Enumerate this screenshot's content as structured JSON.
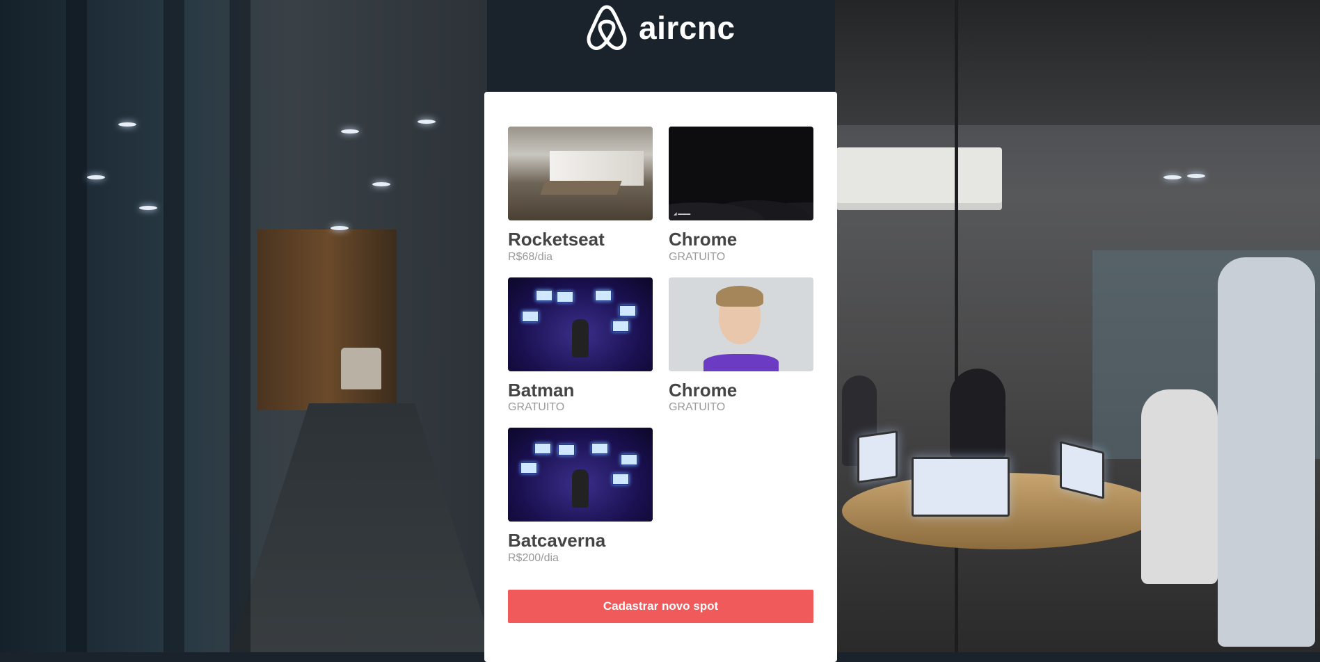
{
  "app": {
    "logo_text": "aircnc",
    "logo_icon": "airbnb-belo-icon"
  },
  "spots": [
    {
      "name": "Rocketseat",
      "price": "R$68/dia",
      "image": "office-room"
    },
    {
      "name": "Chrome",
      "price": "GRATUITO",
      "image": "dark-banner"
    },
    {
      "name": "Batman",
      "price": "GRATUITO",
      "image": "batcave"
    },
    {
      "name": "Chrome",
      "price": "GRATUITO",
      "image": "portrait"
    },
    {
      "name": "Batcaverna",
      "price": "R$200/dia",
      "image": "batcave"
    }
  ],
  "actions": {
    "new_spot_label": "Cadastrar novo spot"
  },
  "colors": {
    "accent": "#f05a5b",
    "card_bg": "#ffffff",
    "title_text": "#444444",
    "price_text": "#999999"
  }
}
